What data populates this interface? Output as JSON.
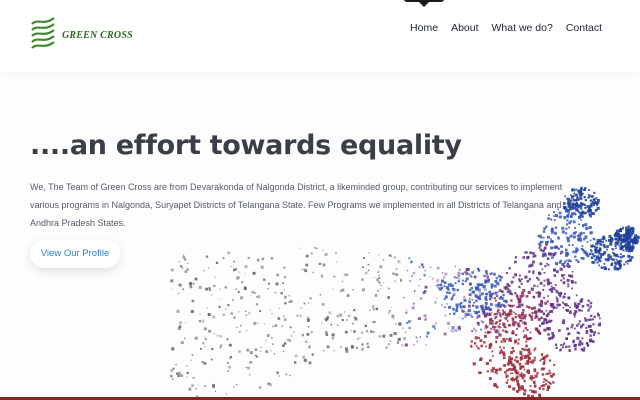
{
  "brand": {
    "name": "GREEN CROSS",
    "icon": "green-wave-stripes-logo",
    "color": "#2e6b1f"
  },
  "nav": {
    "items": [
      {
        "label": "Home",
        "active": true
      },
      {
        "label": "About",
        "active": false
      },
      {
        "label": "What we do?",
        "active": false
      },
      {
        "label": "Contact",
        "active": false
      }
    ]
  },
  "hero": {
    "headline": "....an effort towards equality",
    "description": "We, The Team of Green Cross are from Devarakonda of Nalgonda District, a likeminded group, contributing our services to implement various programs in Nalgonda, Suryapet Districts of Telangana State. Few Programs we implemented in all Districts of Telangana and Andhra Pradesh States.",
    "button_label": "View Our Profile",
    "button_color": "#2a7fc8",
    "image": "particle-runner-illustration"
  },
  "colors": {
    "headline": "#3a3f47",
    "accent_bottom": "#8a2222",
    "particles": [
      "#1e3f9a",
      "#3457b8",
      "#5a2d83",
      "#8a2a5a",
      "#9a2a3a",
      "#555555"
    ]
  }
}
